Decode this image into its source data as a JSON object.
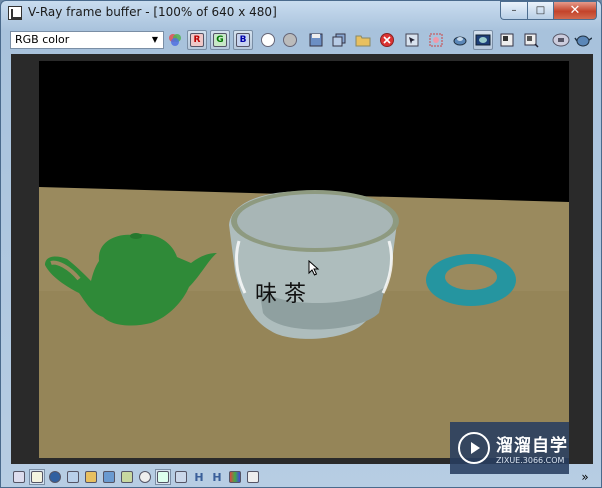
{
  "window": {
    "title": "V-Ray frame buffer - [100% of 640 x 480]",
    "min_glyph": "–",
    "max_glyph": "□",
    "close_glyph": "✕"
  },
  "toolbar": {
    "channel_value": "RGB color",
    "channel_arrow": "▼",
    "buttons": [
      {
        "name": "view-channel-icon",
        "label": ""
      },
      {
        "name": "red-channel-button",
        "label": "R"
      },
      {
        "name": "green-channel-button",
        "label": "G"
      },
      {
        "name": "blue-channel-button",
        "label": "B"
      },
      {
        "name": "white-display-button",
        "label": ""
      },
      {
        "name": "mono-display-button",
        "label": ""
      },
      {
        "name": "save-image-icon",
        "label": ""
      },
      {
        "name": "duplicate-vfb-icon",
        "label": ""
      },
      {
        "name": "load-image-icon",
        "label": ""
      },
      {
        "name": "clear-image-icon",
        "label": ""
      },
      {
        "name": "track-mouse-icon",
        "label": ""
      },
      {
        "name": "region-render-icon",
        "label": ""
      },
      {
        "name": "link-icon",
        "label": ""
      },
      {
        "name": "lens-effects-icon",
        "label": ""
      },
      {
        "name": "color-corrections-icon",
        "label": ""
      },
      {
        "name": "history-icon",
        "label": ""
      },
      {
        "name": "stop-render-icon",
        "label": ""
      },
      {
        "name": "render-icon",
        "label": ""
      }
    ]
  },
  "statusbar": {
    "expand_glyph": "»",
    "letters": {
      "h1": "H",
      "h2": "H"
    }
  },
  "watermark": {
    "main": "溜溜自学",
    "sub": "ZIXUE.3066.COM"
  },
  "scene": {
    "cup_text": "味 茶",
    "background_top": "#000000",
    "table_color": "#9a8a5e",
    "teapot_color": "#2f8a38",
    "cup_color": "#aebdbd",
    "torus_color": "#2595a0"
  }
}
